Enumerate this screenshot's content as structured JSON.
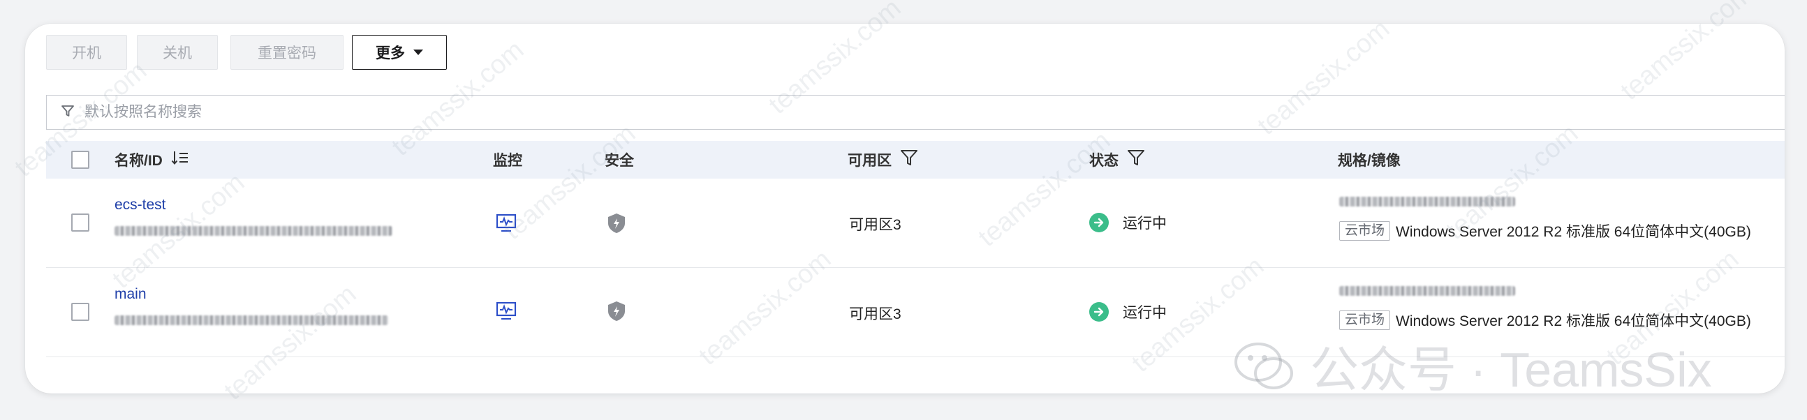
{
  "toolbar": {
    "start_label": "开机",
    "stop_label": "关机",
    "reset_password_label": "重置密码",
    "more_label": "更多"
  },
  "search": {
    "placeholder": "默认按照名称搜索"
  },
  "table": {
    "headers": {
      "name": "名称/ID",
      "monitor": "监控",
      "security": "安全",
      "zone": "可用区",
      "status": "状态",
      "spec": "规格/镜像"
    },
    "rows": [
      {
        "name": "ecs-test",
        "zone": "可用区3",
        "status": "运行中",
        "market_tag": "云市场",
        "image": "Windows Server 2012 R2 标准版 64位简体中文(40GB)"
      },
      {
        "name": "main",
        "zone": "可用区3",
        "status": "运行中",
        "market_tag": "云市场",
        "image": "Windows Server 2012 R2 标准版 64位简体中文(40GB)"
      }
    ]
  },
  "watermark": {
    "text": "teamssix.com",
    "brand": "公众号 · TeamsSix"
  },
  "colors": {
    "link": "#1f3fa8",
    "running": "#3bbd8a",
    "header_bg": "#eef2f9"
  }
}
